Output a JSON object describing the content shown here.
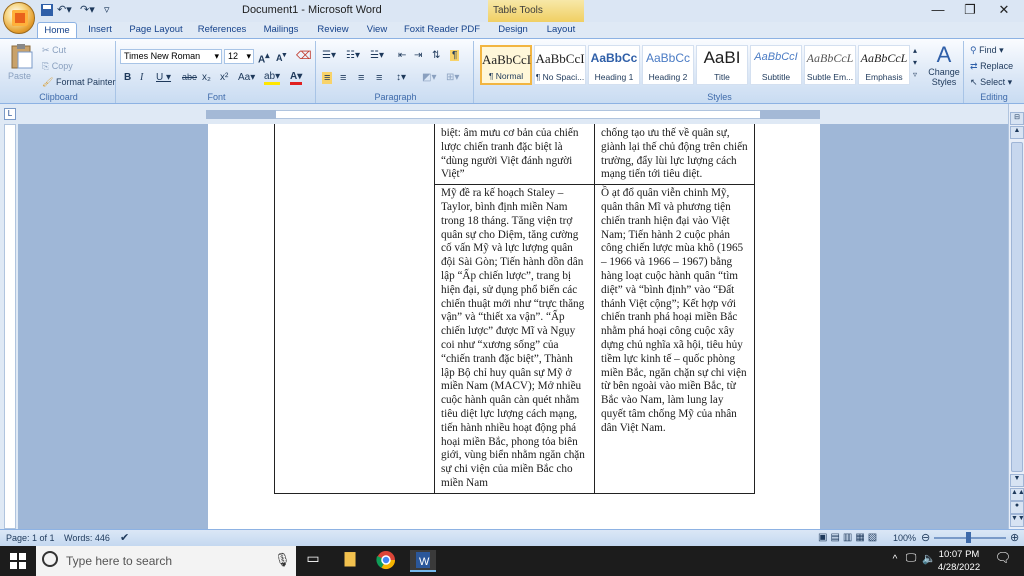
{
  "window": {
    "title": "Document1 - Microsoft Word",
    "contextual_tab_group": "Table Tools"
  },
  "quick_access": {
    "save_icon": "save-icon",
    "undo_icon": "undo-icon",
    "redo_icon": "redo-icon"
  },
  "tabs": [
    "Home",
    "Insert",
    "Page Layout",
    "References",
    "Mailings",
    "Review",
    "View",
    "Foxit Reader PDF",
    "Design",
    "Layout"
  ],
  "ribbon": {
    "clipboard": {
      "label": "Clipboard",
      "paste": "Paste",
      "cut": "Cut",
      "copy": "Copy",
      "format_painter": "Format Painter"
    },
    "font": {
      "label": "Font",
      "name": "Times New Roman",
      "size": "12"
    },
    "paragraph": {
      "label": "Paragraph"
    },
    "styles": {
      "label": "Styles",
      "items": [
        {
          "sample": "AaBbCcI",
          "name": "¶ Normal"
        },
        {
          "sample": "AaBbCcI",
          "name": "¶ No Spaci..."
        },
        {
          "sample": "AaBbCc",
          "name": "Heading 1"
        },
        {
          "sample": "AaBbCc",
          "name": "Heading 2"
        },
        {
          "sample": "AaBI",
          "name": "Title"
        },
        {
          "sample": "AaBbCcI",
          "name": "Subtitle"
        },
        {
          "sample": "AaBbCcL",
          "name": "Subtle Em..."
        },
        {
          "sample": "AaBbCcL",
          "name": "Emphasis"
        }
      ],
      "change_styles": "Change Styles"
    },
    "editing": {
      "label": "Editing",
      "find": "Find",
      "replace": "Replace",
      "select": "Select"
    }
  },
  "document": {
    "row1": {
      "col2": "biệt: âm mưu cơ bản của chiến lược chiến tranh đặc biệt là “dùng người Việt đánh người Việt”",
      "col3": "chống tạo ưu thế về quân sự, giành lại thế chủ động trên chiến trường, đẩy lùi lực lượng cách mạng tiến tới tiêu diệt."
    },
    "row2": {
      "col2": "Mỹ đề ra kế hoạch Staley – Taylor, bình định miền Nam trong 18 tháng. Tăng viện trợ quân sự cho Diệm, tăng cường cố vấn Mỹ và lực lượng quân đội Sài Gòn; Tiến hành dồn dân lập “Ấp chiến lược”, trang bị hiện đại, sử dụng phổ biến các chiến thuật mới như “trực thăng vận” và “thiết xa vận”. “Ấp chiến lược” được Mĩ và Ngụy coi như “xương sống” của “chiến tranh đặc biệt”, Thành lập Bộ chỉ huy quân sự Mỹ ở miền Nam (MACV); Mở nhiều cuộc hành quân càn quét nhằm tiêu diệt lực lượng cách mạng, tiến hành nhiều hoạt động phá hoại miền Bắc, phong tỏa biên giới, vùng biển nhằm ngăn chặn sự chi viện của miền Bắc cho miền Nam",
      "col3": "Ồ ạt đổ quân viễn chinh Mỹ, quân thân Mĩ và phương tiện chiến tranh hiện đại vào Việt Nam; Tiến hành 2 cuộc phản công chiến lược mùa khô (1965 – 1966 và 1966 – 1967) bằng hàng loạt cuộc hành quân “tìm diệt” và “bình định” vào “Đất thánh Việt cộng”; Kết hợp với chiến tranh phá hoại miền Bắc nhằm phá hoại công cuộc xây dựng chủ nghĩa xã hội, tiêu hủy tiềm lực kinh tế – quốc phòng miền Bắc, ngăn chặn sự chi viện từ bên ngoài vào miền Bắc, từ Bắc vào Nam, làm lung lay quyết tâm chống Mỹ của nhân dân Việt Nam."
    }
  },
  "status": {
    "page": "Page: 1 of 1",
    "words": "Words: 446",
    "zoom": "100%"
  },
  "taskbar": {
    "search_placeholder": "Type here to search",
    "time": "10:07 PM",
    "date": "4/28/2022"
  }
}
